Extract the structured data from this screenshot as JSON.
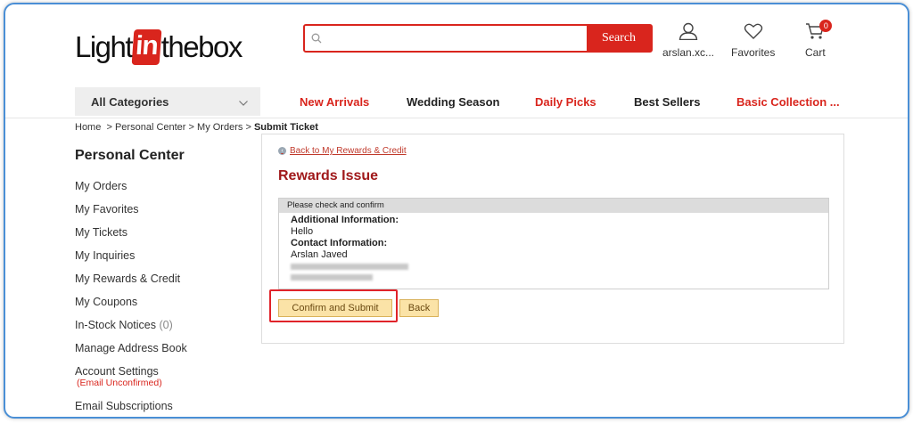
{
  "header": {
    "logo": {
      "part1": "Light",
      "part2": "in",
      "part3": "thebox"
    },
    "search": {
      "placeholder": "",
      "button_label": "Search"
    },
    "account_label": "arslan.xc...",
    "favorites_label": "Favorites",
    "cart_label": "Cart",
    "cart_count": "0"
  },
  "nav": {
    "all_categories": "All Categories",
    "links": [
      {
        "label": "New Arrivals",
        "color": "#d9251d"
      },
      {
        "label": "Wedding Season",
        "color": "#222222"
      },
      {
        "label": "Daily Picks",
        "color": "#d9251d"
      },
      {
        "label": "Best Sellers",
        "color": "#222222"
      },
      {
        "label": "Basic Collection ...",
        "color": "#d9251d"
      }
    ]
  },
  "breadcrumb": {
    "home": "Home",
    "sep": ">",
    "personal_center": "Personal Center",
    "my_orders": "My Orders",
    "current": "Submit Ticket"
  },
  "sidebar": {
    "title": "Personal Center",
    "items": [
      {
        "label": "My Orders"
      },
      {
        "label": "My Favorites"
      },
      {
        "label": "My Tickets"
      },
      {
        "label": "My Inquiries"
      },
      {
        "label": "My Rewards & Credit"
      },
      {
        "label": "My Coupons"
      },
      {
        "label": "In-Stock Notices",
        "count": "(0)"
      },
      {
        "label": "Manage Address Book"
      },
      {
        "label": "Account Settings",
        "note": "(Email Unconfirmed)"
      },
      {
        "label": "Email Subscriptions"
      }
    ]
  },
  "main": {
    "back_link": "Back to My Rewards & Credit",
    "title": "Rewards Issue",
    "confirm_header": "Please check and confirm",
    "additional_info_label": "Additional Information:",
    "additional_info_value": "Hello",
    "contact_info_label": "Contact Information:",
    "contact_name": "Arslan Javed",
    "confirm_button": "Confirm and Submit",
    "back_button": "Back"
  },
  "colors": {
    "brand_red": "#d9251d",
    "title_red": "#a0191b",
    "button_yellow": "#fbe3a7",
    "frame_blue": "#4a8fd6"
  }
}
